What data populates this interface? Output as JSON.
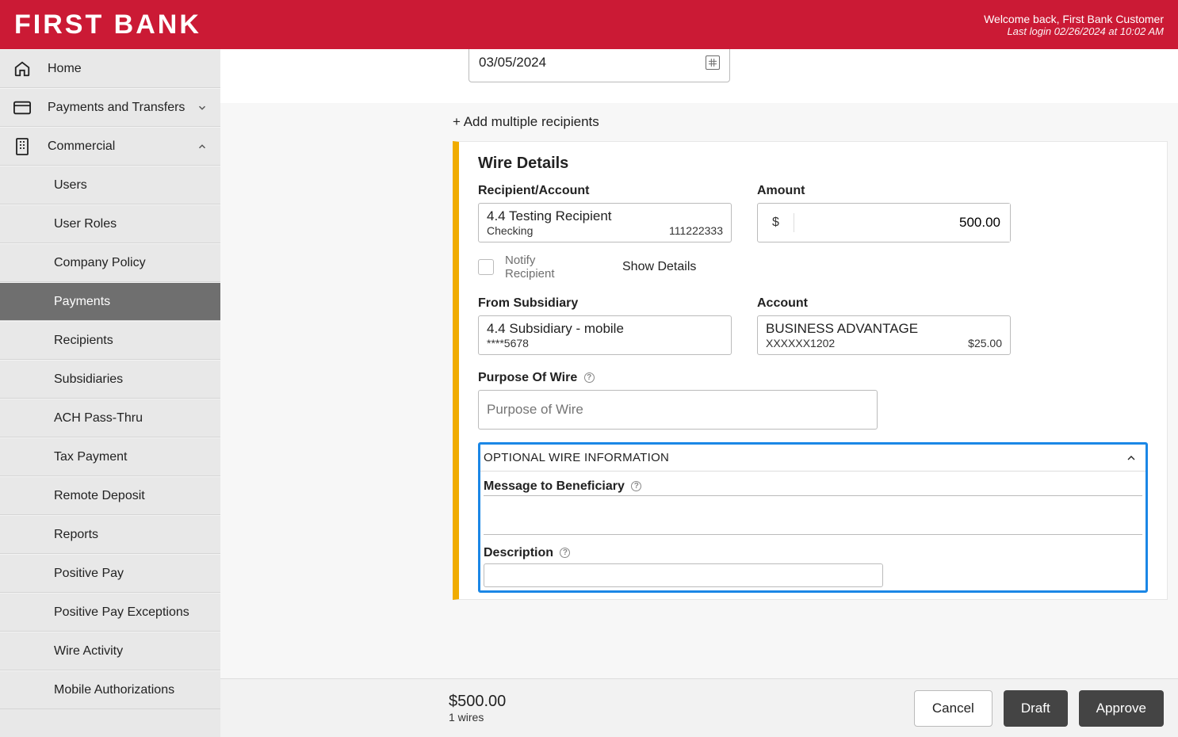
{
  "header": {
    "logo": "FIRST BANK",
    "welcome": "Welcome back, First Bank Customer",
    "last_login": "Last login 02/26/2024 at 10:02 AM"
  },
  "sidebar": {
    "home": "Home",
    "payments_transfers": "Payments and Transfers",
    "commercial": "Commercial",
    "subs": {
      "users": "Users",
      "user_roles": "User Roles",
      "company_policy": "Company Policy",
      "payments": "Payments",
      "recipients": "Recipients",
      "subsidiaries": "Subsidiaries",
      "ach": "ACH Pass-Thru",
      "tax": "Tax Payment",
      "remote": "Remote Deposit",
      "reports": "Reports",
      "pospay": "Positive Pay",
      "pospay_exc": "Positive Pay Exceptions",
      "wire_activity": "Wire Activity",
      "mobile_auth": "Mobile Authorizations"
    }
  },
  "date": {
    "value": "03/05/2024"
  },
  "add_recip": "+ Add multiple recipients",
  "wire": {
    "title": "Wire Details",
    "recipient_label": "Recipient/Account",
    "recipient_name": "4.4 Testing Recipient",
    "recipient_type": "Checking",
    "recipient_num": "111222333",
    "amount_label": "Amount",
    "amount_symbol": "$",
    "amount_value": "500.00",
    "notify_label": "Notify Recipient",
    "show_details": "Show Details",
    "from_sub_label": "From Subsidiary",
    "from_sub_name": "4.4 Subsidiary - mobile",
    "from_sub_num": "****5678",
    "account_label": "Account",
    "account_name": "BUSINESS ADVANTAGE",
    "account_num": "XXXXXX1202",
    "account_bal": "$25.00",
    "purpose_label": "Purpose Of Wire",
    "purpose_placeholder": "Purpose of Wire",
    "optional_title": "OPTIONAL WIRE INFORMATION",
    "msg_label": "Message to Beneficiary",
    "desc_label": "Description"
  },
  "footer": {
    "total": "$500.00",
    "count": "1 wires",
    "cancel": "Cancel",
    "draft": "Draft",
    "approve": "Approve"
  }
}
